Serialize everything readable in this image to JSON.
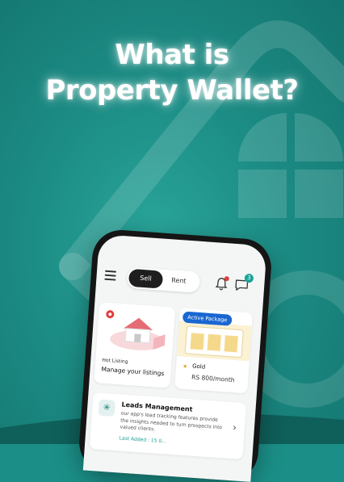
{
  "headline": {
    "line1": "What is",
    "line2": "Property Wallet?"
  },
  "app": {
    "toggle": {
      "active": "Sell",
      "inactive": "Rent"
    },
    "chat_badge": "3",
    "listing_card": {
      "small": "Hot Listing",
      "title": "Manage your listings"
    },
    "package_card": {
      "badge": "Active Package",
      "name": "Gold",
      "price": "RS 800/month"
    },
    "leads_card": {
      "title": "Leads Management",
      "description": "our app's lead tracking features provide the insights needed to turn prospects into valued clients.",
      "last_added": "Last Added : 15 0..."
    }
  },
  "colors": {
    "background": "#1b8f87",
    "accent": "#1aa39a",
    "badge_blue": "#1a67d2",
    "alert": "#e23b3b"
  }
}
